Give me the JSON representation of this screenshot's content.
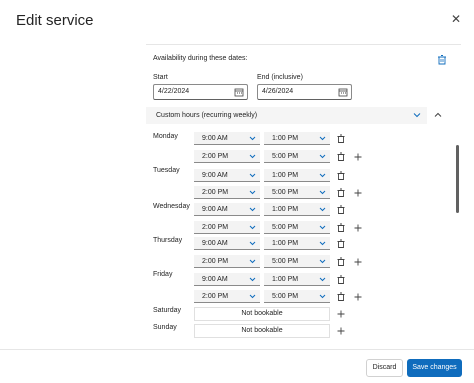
{
  "dialog": {
    "title": "Edit service",
    "close_icon": "close-icon"
  },
  "availability": {
    "title": "Availability during these dates:",
    "start_label": "Start",
    "start_value": "4/22/2024",
    "end_label": "End (inclusive)",
    "end_value": "4/26/2024",
    "mode": "Custom hours (recurring weekly)"
  },
  "schedule": {
    "monday": {
      "label": "Monday",
      "r1_from": "9:00 AM",
      "r1_to": "1:00 PM",
      "r2_from": "2:00 PM",
      "r2_to": "5:00 PM"
    },
    "tuesday": {
      "label": "Tuesday",
      "r1_from": "9:00 AM",
      "r1_to": "1:00 PM",
      "r2_from": "2:00 PM",
      "r2_to": "5:00 PM"
    },
    "wednesday": {
      "label": "Wednesday",
      "r1_from": "9:00 AM",
      "r1_to": "1:00 PM",
      "r2_from": "2:00 PM",
      "r2_to": "5:00 PM"
    },
    "thursday": {
      "label": "Thursday",
      "r1_from": "9:00 AM",
      "r1_to": "1:00 PM",
      "r2_from": "2:00 PM",
      "r2_to": "5:00 PM"
    },
    "friday": {
      "label": "Friday",
      "r1_from": "9:00 AM",
      "r1_to": "1:00 PM",
      "r2_from": "2:00 PM",
      "r2_to": "5:00 PM"
    },
    "saturday": {
      "label": "Saturday",
      "status": "Not bookable"
    },
    "sunday": {
      "label": "Sunday",
      "status": "Not bookable"
    }
  },
  "footer": {
    "discard_label": "Discard",
    "save_label": "Save changes"
  },
  "colors": {
    "accent": "#0f6cbd",
    "field_bg": "#f3f3f3"
  }
}
